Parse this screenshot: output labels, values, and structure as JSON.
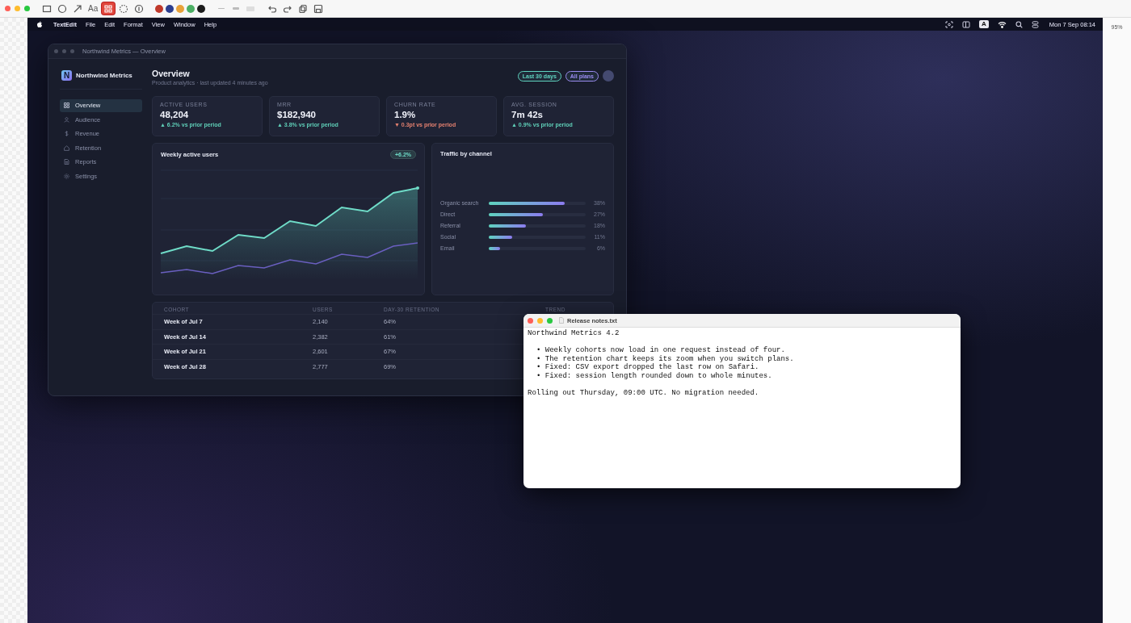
{
  "editor_toolbar": {
    "tools": [
      {
        "kind": "rect",
        "selected": false
      },
      {
        "kind": "circle",
        "selected": false
      },
      {
        "kind": "arrow",
        "selected": false
      },
      {
        "kind": "text",
        "label": "Aa",
        "selected": false
      },
      {
        "kind": "pixelate",
        "selected": true
      },
      {
        "kind": "blur",
        "selected": false
      },
      {
        "kind": "counter",
        "selected": false
      }
    ],
    "colors": [
      {
        "color": "#c0392b"
      },
      {
        "color": "#2c3e8f"
      },
      {
        "color": "#e8a23a"
      },
      {
        "color": "#4caf64"
      },
      {
        "color": "#1c1c1c"
      }
    ],
    "widths": [
      {
        "kind": "thin",
        "selected": false
      },
      {
        "kind": "medium",
        "selected": false
      },
      {
        "kind": "thick",
        "selected": false
      }
    ],
    "actions": [
      {
        "kind": "undo"
      },
      {
        "kind": "redo"
      },
      {
        "kind": "copy"
      },
      {
        "kind": "save"
      }
    ],
    "zoom": "95%"
  },
  "menu_bar": {
    "app": "TextEdit",
    "items": [
      "File",
      "Edit",
      "Format",
      "View",
      "Window",
      "Help"
    ],
    "input_source": "A",
    "clock": "Mon 7 Sep  08:14"
  },
  "dashboard": {
    "title": "Northwind Metrics — Overview",
    "logo_letter": "N",
    "brand": "Northwind Metrics",
    "nav": [
      {
        "label": "Overview",
        "kind": "grid",
        "selected": true
      },
      {
        "label": "Audience",
        "kind": "person",
        "selected": false
      },
      {
        "label": "Revenue",
        "kind": "dollar",
        "selected": false
      },
      {
        "label": "Retention",
        "kind": "home",
        "selected": false
      },
      {
        "label": "Reports",
        "kind": "doc",
        "selected": false
      },
      {
        "label": "Settings",
        "kind": "gear",
        "selected": false
      }
    ],
    "heading": "Overview",
    "subtitle": "Product analytics · last updated 4 minutes ago",
    "filters": [
      {
        "label": "Last 30 days",
        "color": "#5fd3bf"
      },
      {
        "label": "All plans",
        "color": "#9a8cf0"
      }
    ],
    "kpis": [
      {
        "label": "ACTIVE USERS",
        "value": "48,204",
        "delta": "▲ 6.2% vs prior period",
        "color": "#5fcfb8"
      },
      {
        "label": "MRR",
        "value": "$182,940",
        "delta": "▲ 3.8% vs prior period",
        "color": "#5fcfb8"
      },
      {
        "label": "CHURN RATE",
        "value": "1.9%",
        "delta": "▼ 0.3pt vs prior period",
        "color": "#e4806f"
      },
      {
        "label": "AVG. SESSION",
        "value": "7m 42s",
        "delta": "▲ 0.9% vs prior period",
        "color": "#5fcfb8"
      }
    ],
    "wau": {
      "title": "Weekly active users",
      "badge": "+6.2%"
    },
    "traffic": {
      "title": "Traffic by channel",
      "channels": [
        {
          "name": "Organic search",
          "level": 0.78,
          "reading": "38%"
        },
        {
          "name": "Direct",
          "level": 0.56,
          "reading": "27%"
        },
        {
          "name": "Referral",
          "level": 0.38,
          "reading": "18%"
        },
        {
          "name": "Social",
          "level": 0.24,
          "reading": "11%"
        },
        {
          "name": "Email",
          "level": 0.12,
          "reading": "6%"
        }
      ]
    },
    "cohorts": {
      "columns": [
        "COHORT",
        "USERS",
        "DAY-30 RETENTION",
        "TREND"
      ],
      "rows": [
        [
          "Week of Jul 7",
          "2,140",
          "64%"
        ],
        [
          "Week of Jul 14",
          "2,382",
          "61%"
        ],
        [
          "Week of Jul 21",
          "2,601",
          "67%"
        ],
        [
          "Week of Jul 28",
          "2,777",
          "69%"
        ]
      ]
    }
  },
  "textedit": {
    "title": "Release notes.txt",
    "heading": "Northwind Metrics 4.2",
    "bullets": [
      "• Weekly cohorts now load in one request instead of four.",
      "• The retention chart keeps its zoom when you switch plans.",
      "• Fixed: CSV export dropped the last row on Safari.",
      "• Fixed: session length rounded down to whole minutes."
    ],
    "footer": "Rolling out Thursday, 09:00 UTC. No migration needed."
  }
}
